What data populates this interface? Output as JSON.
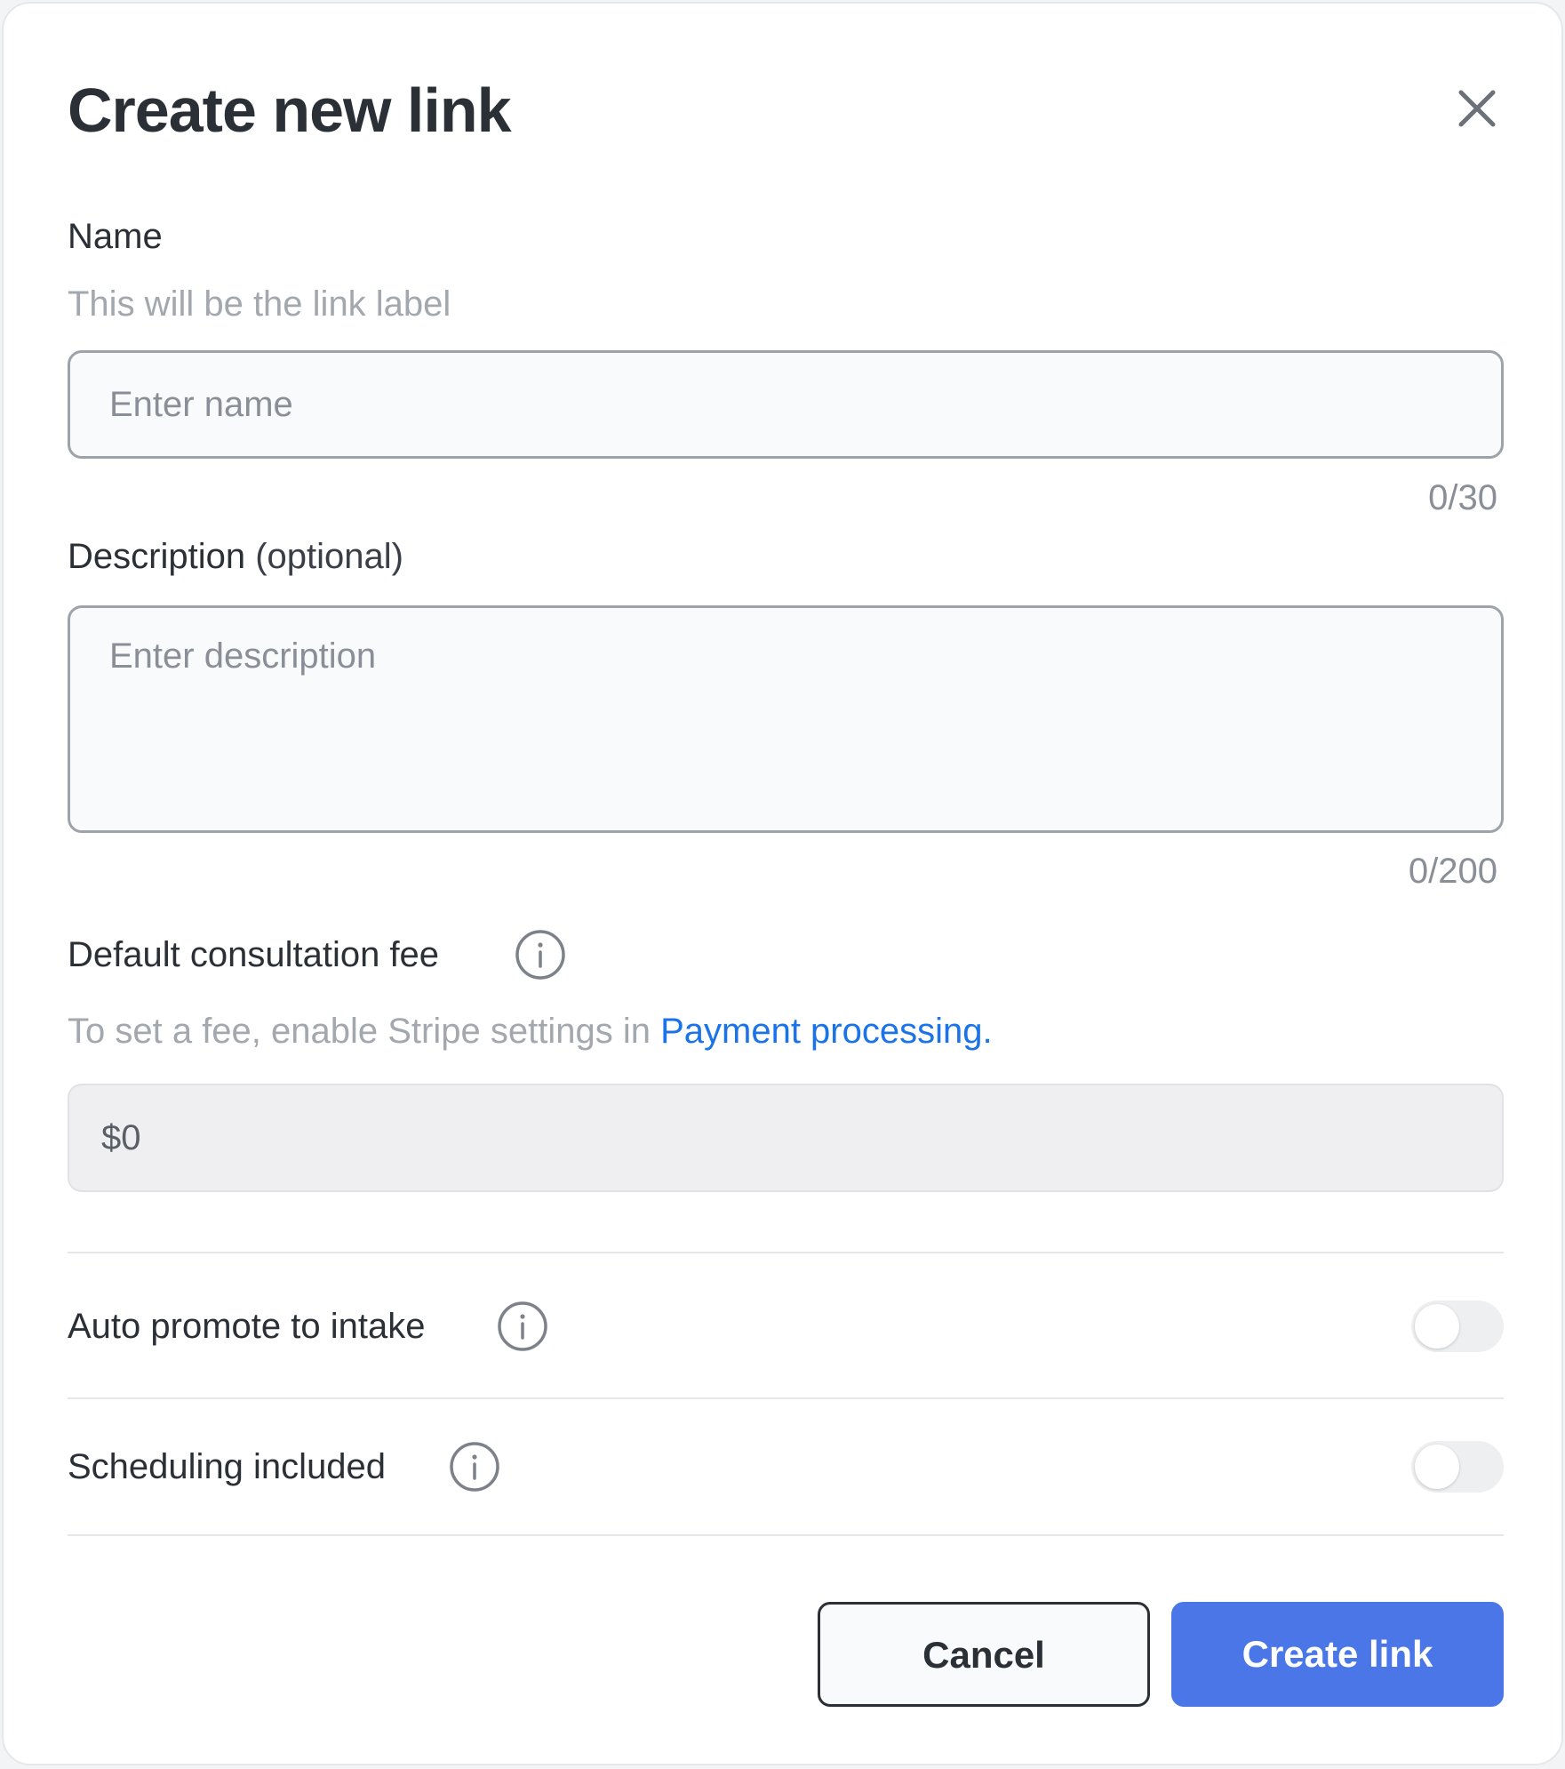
{
  "dialog": {
    "title": "Create new link",
    "close_icon": "close-icon"
  },
  "name_section": {
    "label": "Name",
    "helper": "This will be the link label",
    "placeholder": "Enter name",
    "value": "",
    "counter": "0/30"
  },
  "description_section": {
    "label": "Description",
    "label_suffix": " (optional)",
    "placeholder": "Enter description",
    "value": "",
    "counter": "0/200"
  },
  "fee_section": {
    "label": "Default consultation fee",
    "info_icon": "info-icon",
    "helper_prefix": "To set a fee, enable Stripe settings in ",
    "helper_link": "Payment processing.",
    "value": "$0"
  },
  "toggles": [
    {
      "label": "Auto promote to intake",
      "on": false,
      "info_icon": "info-icon"
    },
    {
      "label": "Scheduling included",
      "on": false,
      "info_icon": "info-icon"
    }
  ],
  "footer": {
    "cancel_label": "Cancel",
    "submit_label": "Create link"
  },
  "colors": {
    "primary": "#4a76e8",
    "link": "#1a73e8",
    "text": "#2b2f36",
    "muted": "#a3a7ae"
  }
}
